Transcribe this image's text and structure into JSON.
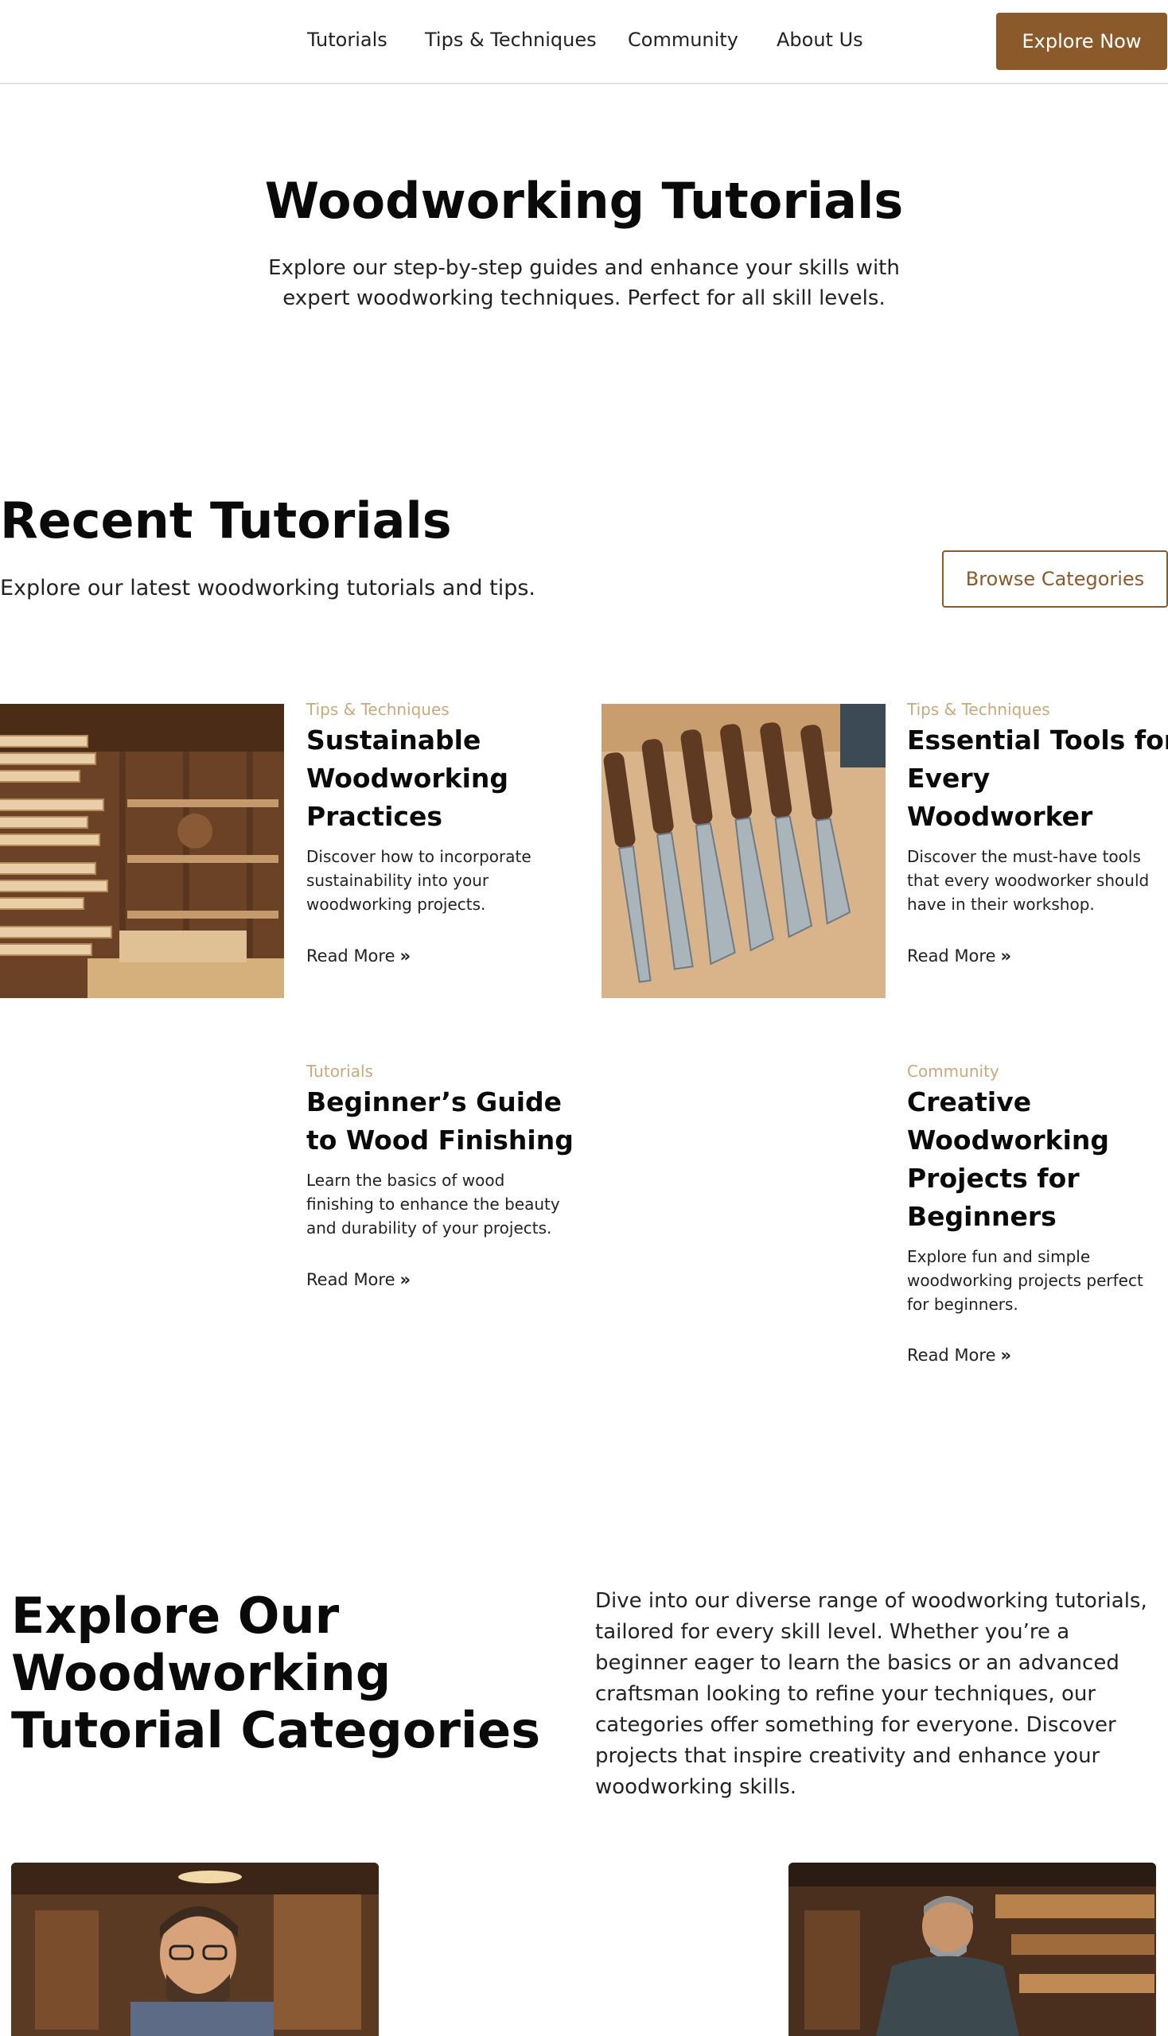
{
  "nav": {
    "links": [
      "Tutorials",
      "Tips & Techniques",
      "Community",
      "About Us"
    ],
    "cta": "Explore Now"
  },
  "hero": {
    "title": "Woodworking Tutorials",
    "subtitle": "Explore our step-by-step guides and enhance your skills with expert woodworking techniques. Perfect for all skill levels."
  },
  "recent": {
    "title": "Recent Tutorials",
    "subtitle": "Explore our latest woodworking tutorials and tips.",
    "browse_label": "Browse Categories",
    "read_more": "Read More",
    "cards": [
      {
        "category": "Tips & Techniques",
        "title": "Sustainable Woodworking Practices",
        "desc": "Discover how to incorporate sustainability into your woodworking projects."
      },
      {
        "category": "Tips & Techniques",
        "title": "Essential Tools for Every Woodworker",
        "desc": "Discover the must-have tools that every woodworker should have in their workshop."
      },
      {
        "category": "Tutorials",
        "title": "Beginner’s Guide to Wood Finishing",
        "desc": "Learn the basics of wood finishing to enhance the beauty and durability of your projects."
      },
      {
        "category": "Community",
        "title": "Creative Woodworking Projects for Beginners",
        "desc": "Explore fun and simple woodworking projects perfect for beginners."
      }
    ]
  },
  "categories": {
    "title": "Explore Our Woodworking Tutorial Categories",
    "text": "Dive into our diverse range of woodworking tutorials, tailored for every skill level. Whether you’re a beginner eager to learn the basics or an advanced craftsman looking to refine your techniques, our categories offer something for everyone. Discover projects that inspire creativity and enhance your woodworking skills."
  },
  "colors": {
    "accent": "#8b5a2b",
    "category": "#c8a97a"
  }
}
